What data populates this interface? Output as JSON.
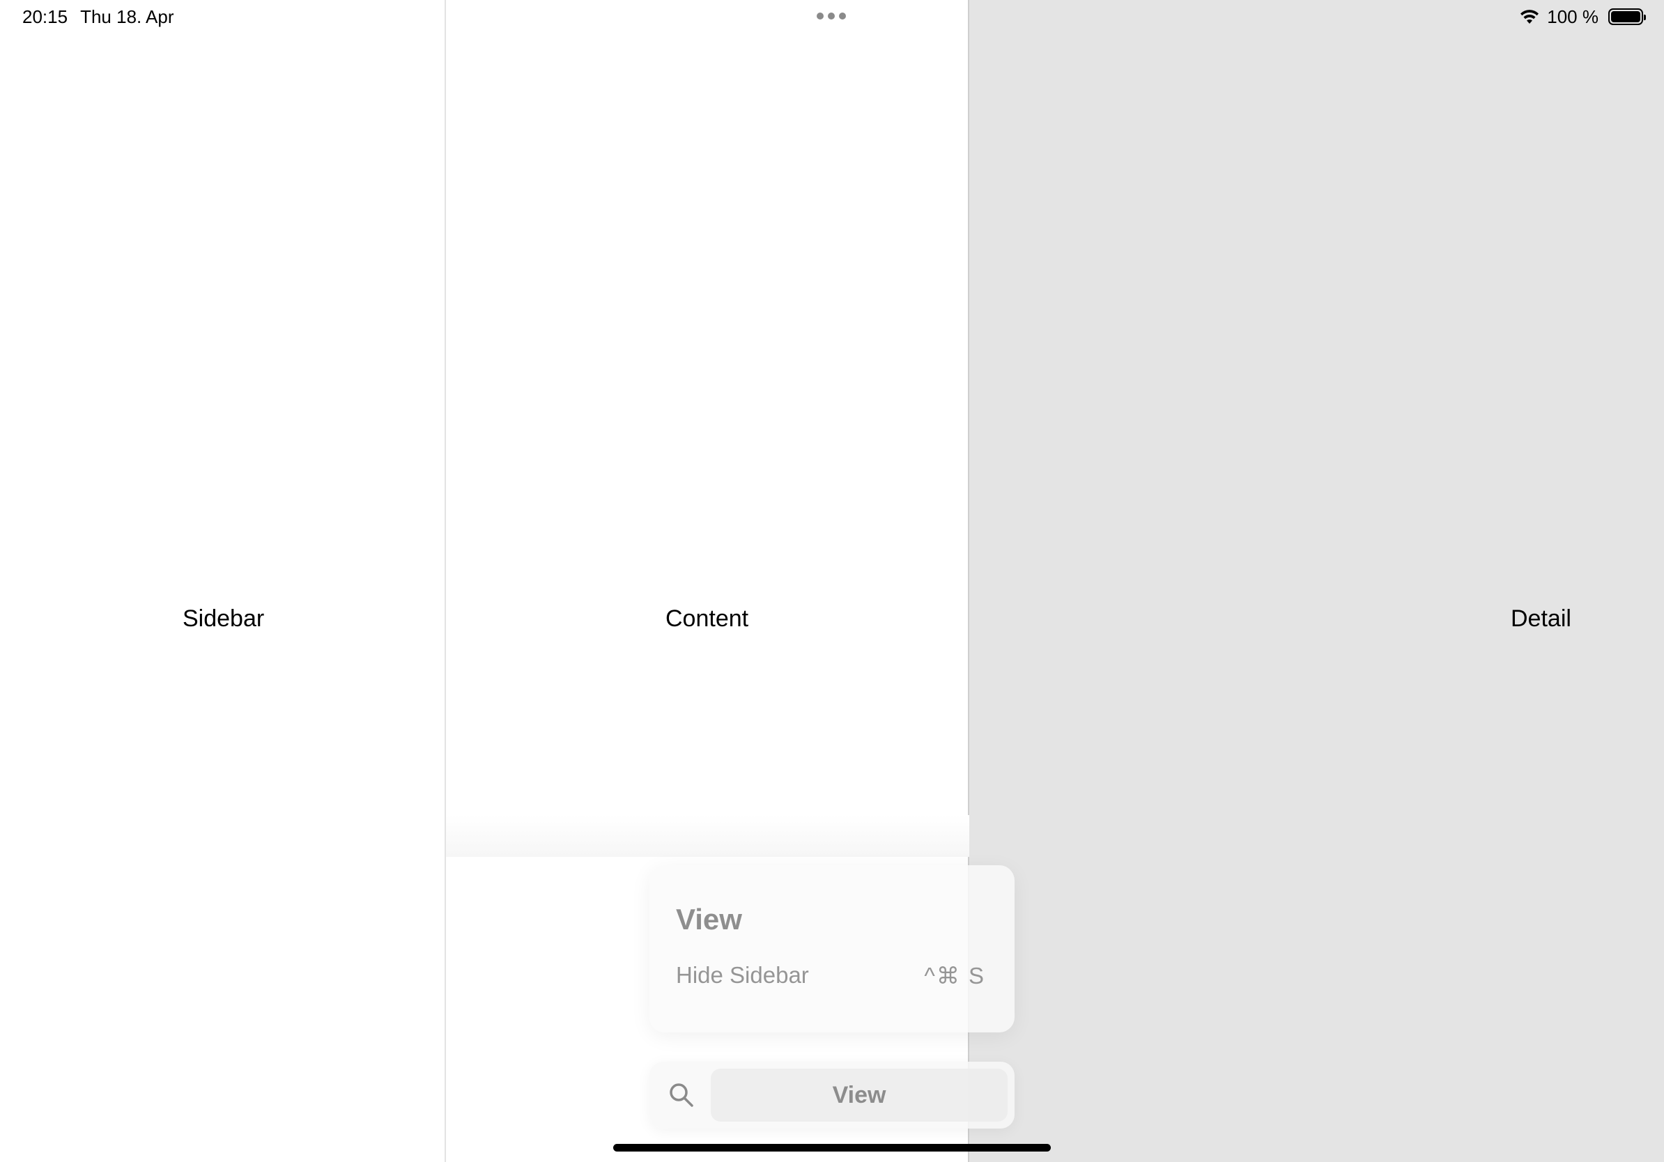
{
  "status_bar": {
    "time": "20:15",
    "date": "Thu 18. Apr",
    "battery_percent": "100 %",
    "icons": [
      "wifi-icon",
      "battery-icon"
    ]
  },
  "columns": {
    "sidebar_label": "Sidebar",
    "content_label": "Content",
    "detail_label": "Detail"
  },
  "menu": {
    "title": "View",
    "items": [
      {
        "label": "Hide Sidebar",
        "shortcut": "^⌘ S"
      }
    ]
  },
  "search": {
    "icon": "search-icon",
    "value": "View"
  },
  "colors": {
    "detail_background": "#e4e4e4",
    "menu_text": "#959595"
  }
}
